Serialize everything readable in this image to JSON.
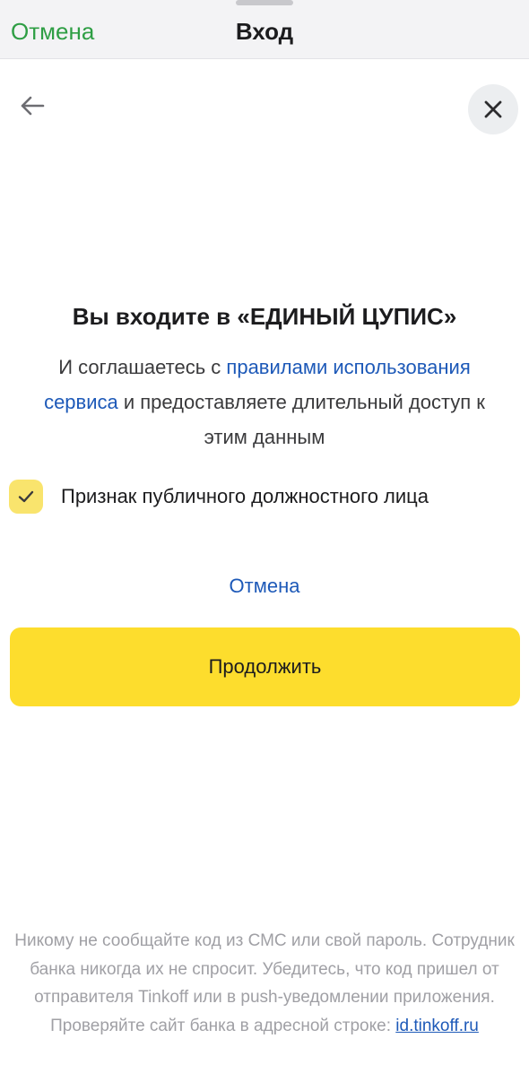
{
  "header": {
    "cancel_label": "Отмена",
    "title": "Вход"
  },
  "icons": {
    "back": "arrow-left-icon",
    "close": "close-icon",
    "check": "checkmark-icon"
  },
  "main": {
    "heading": "Вы входите в «ЕДИНЫЙ ЦУПИС»",
    "agreement_prefix": "И соглашаетесь с ",
    "agreement_link": "правилами использования сервиса",
    "agreement_suffix": " и предоставляете длительный доступ к этим данным",
    "checkbox_label": "Признак публичного должностного лица",
    "checkbox_checked": true,
    "cancel_link": "Отмена",
    "continue_button": "Продолжить"
  },
  "footer": {
    "notice": "Никому не сообщайте код из СМС или свой пароль. Сотрудник банка никогда их не спросит. Убедитесь, что код пришел от отправителя Tinkoff или в push-уведомлении приложения. Проверяйте сайт банка в адресной строке: ",
    "site_link": "id.tinkoff.ru"
  },
  "colors": {
    "accent_green": "#2e9e44",
    "link_blue": "#1d59b8",
    "button_yellow": "#fddd2d",
    "checkbox_yellow": "#f9e46d"
  }
}
